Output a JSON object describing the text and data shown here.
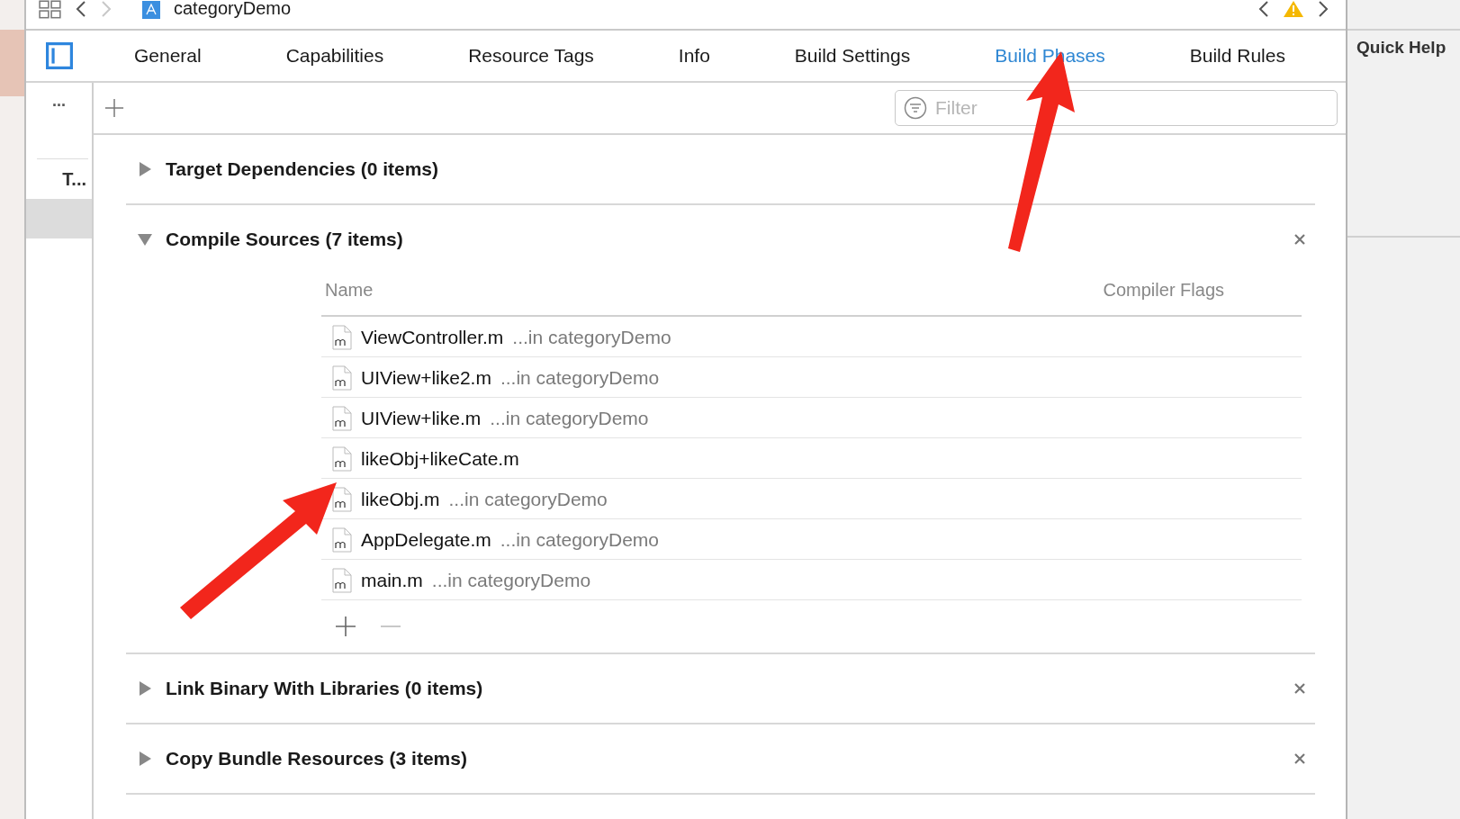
{
  "toolbar": {
    "title": "categoryDemo",
    "forward_disabled": true
  },
  "tabs": [
    {
      "label": "General",
      "selected": false
    },
    {
      "label": "Capabilities",
      "selected": false
    },
    {
      "label": "Resource Tags",
      "selected": false
    },
    {
      "label": "Info",
      "selected": false
    },
    {
      "label": "Build Settings",
      "selected": false
    },
    {
      "label": "Build Phases",
      "selected": true
    },
    {
      "label": "Build Rules",
      "selected": false
    }
  ],
  "sidebar": {
    "more": "...",
    "items": [
      {
        "label": "T...",
        "selected": false
      },
      {
        "selected": true
      }
    ]
  },
  "filter": {
    "placeholder": "Filter"
  },
  "phases": [
    {
      "title": "Target Dependencies (0 items)",
      "expanded": false,
      "removable": false
    },
    {
      "title": "Compile Sources (7 items)",
      "expanded": true,
      "removable": true,
      "columns": [
        "Name",
        "Compiler Flags"
      ],
      "rows": [
        {
          "name": "ViewController.m",
          "location": "...in categoryDemo"
        },
        {
          "name": "UIView+like2.m",
          "location": "...in categoryDemo"
        },
        {
          "name": "UIView+like.m",
          "location": "...in categoryDemo"
        },
        {
          "name": "likeObj+likeCate.m"
        },
        {
          "name": "likeObj.m",
          "location": "...in categoryDemo"
        },
        {
          "name": "AppDelegate.m",
          "location": "...in categoryDemo"
        },
        {
          "name": "main.m",
          "location": "...in categoryDemo"
        }
      ]
    },
    {
      "title": "Link Binary With Libraries (0 items)",
      "expanded": false,
      "removable": true
    },
    {
      "title": "Copy Bundle Resources (3 items)",
      "expanded": false,
      "removable": true
    }
  ],
  "inspector": {
    "title": "Quick Help"
  }
}
